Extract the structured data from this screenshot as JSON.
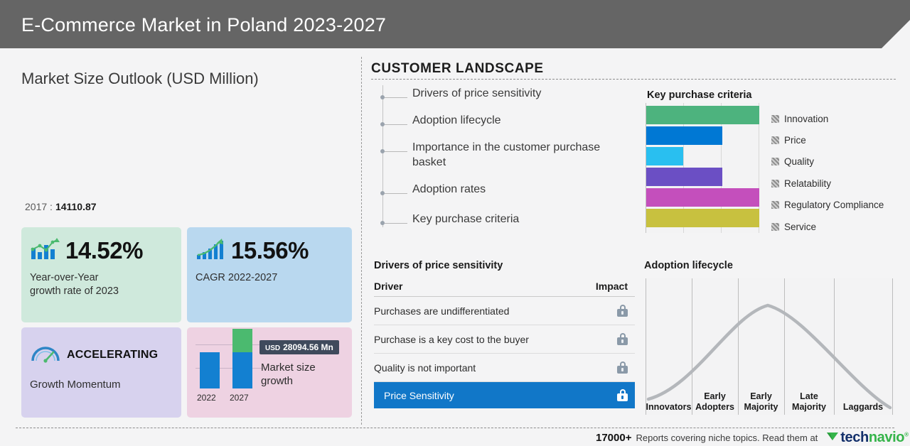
{
  "header": {
    "title": "E-Commerce Market in Poland 2023-2027"
  },
  "left_panel": {
    "title": "Market Size Outlook (USD Million)",
    "baseline": {
      "year": "2017 :",
      "value": "14110.87"
    },
    "cards": {
      "yoy": {
        "icon": "bar-line-chart-icon",
        "value": "14.52%",
        "caption": "Year-over-Year\ngrowth rate of 2023"
      },
      "cagr": {
        "icon": "ascending-bar-arrow-icon",
        "value": "15.56%",
        "caption": "CAGR  2022-2027"
      },
      "momentum": {
        "icon": "speedometer-icon",
        "label": "ACCELERATING",
        "caption": "Growth Momentum"
      },
      "market_size": {
        "badge_unit": "USD",
        "badge_value": "28094.56 Mn",
        "caption": "Market size growth",
        "bar_labels": [
          "2022",
          "2027"
        ]
      }
    }
  },
  "customer_landscape": {
    "title": "CUSTOMER LANDSCAPE",
    "items": [
      {
        "label": "Drivers of price sensitivity"
      },
      {
        "label": "Adoption lifecycle"
      },
      {
        "label": "Importance in the customer purchase basket"
      },
      {
        "label": "Adoption rates"
      },
      {
        "label": "Key purchase criteria"
      }
    ]
  },
  "drivers_table": {
    "title": "Drivers of price sensitivity",
    "columns": [
      "Driver",
      "Impact"
    ],
    "rows": [
      {
        "driver": "Purchases are undifferentiated",
        "impact": "lock-icon",
        "highlight": false
      },
      {
        "driver": "Purchase is a key cost to the buyer",
        "impact": "lock-icon",
        "highlight": false
      },
      {
        "driver": "Quality is not important",
        "impact": "lock-icon",
        "highlight": false
      },
      {
        "driver": "Price Sensitivity",
        "impact": "lock-icon",
        "highlight": true
      }
    ]
  },
  "footer": {
    "count": "17000+",
    "text": "Reports covering niche topics. Read them at",
    "logo": {
      "tech": "tech",
      "navio": "navio",
      "tm": "®",
      "icon": "technavio-arrow-icon"
    }
  },
  "colors": {
    "header_bg": "#656565",
    "page_bg": "#f4f4f5",
    "highlight_blue": "#1177c8",
    "card_yoy": "#cfe9dc",
    "card_cagr": "#b9d8ef",
    "card_momentum": "#d7d2ee",
    "card_market": "#eed2e2",
    "bar_blue": "#1380d1",
    "bar_green": "#4bba6f"
  },
  "chart_data": [
    {
      "type": "bar",
      "title": "Key purchase criteria",
      "orientation": "horizontal",
      "categories": [
        "Innovation",
        "Price",
        "Quality",
        "Relatability",
        "Regulatory Compliance",
        "Service"
      ],
      "values": [
        100,
        67,
        33,
        67,
        100,
        100
      ],
      "colors": [
        "#4db37e",
        "#0078d4",
        "#29bff0",
        "#6b4fc4",
        "#c44fbc",
        "#c8c13f"
      ],
      "xlabel": "",
      "ylabel": "",
      "xlim": [
        0,
        100
      ],
      "grid": true,
      "legend_position": "right",
      "tick_labels": []
    },
    {
      "type": "line",
      "title": "Adoption lifecycle",
      "categories": [
        "Innovators",
        "Early Adopters",
        "Early Majority",
        "Late Majority",
        "Laggards"
      ],
      "x": [
        0,
        12.5,
        25,
        37.5,
        50,
        62.5,
        75,
        87.5,
        100
      ],
      "values": [
        5,
        32,
        58,
        80,
        94,
        88,
        68,
        40,
        8
      ],
      "xlabel": "",
      "ylabel": "",
      "ylim": [
        0,
        100
      ],
      "grid": true,
      "line_color": "#b4b7bb",
      "legend_position": "none"
    },
    {
      "type": "bar",
      "title": "Market size growth",
      "categories": [
        "2022",
        "2027"
      ],
      "series": [
        {
          "name": "base",
          "values": [
            56,
            56
          ],
          "color": "#1380d1"
        },
        {
          "name": "growth",
          "values": [
            0,
            36
          ],
          "color": "#4bba6f"
        }
      ],
      "ylim": [
        0,
        100
      ],
      "grid": true,
      "annotation": "USD 28094.56 Mn"
    }
  ]
}
